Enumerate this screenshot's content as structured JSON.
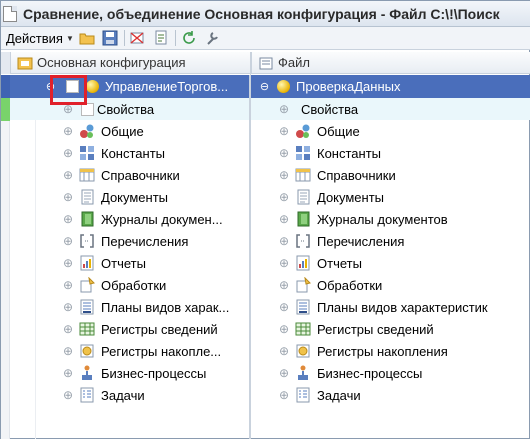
{
  "window": {
    "title": "Сравнение, объединение Основная конфигурация - Файл C:\\!\\Поиск"
  },
  "toolbar": {
    "actions_label": "Действия",
    "buttons": [
      "open-folder-icon",
      "save-icon",
      "filter-icon",
      "report-icon",
      "refresh-icon",
      "settings-icon"
    ]
  },
  "left": {
    "header": "Основная конфигурация",
    "root": "УправлениеТоргов...",
    "items": [
      {
        "label": "Свойства",
        "icon": "checkbox-icon"
      },
      {
        "label": "Общие",
        "icon": "common-icon"
      },
      {
        "label": "Константы",
        "icon": "constants-icon"
      },
      {
        "label": "Справочники",
        "icon": "catalogs-icon"
      },
      {
        "label": "Документы",
        "icon": "documents-icon"
      },
      {
        "label": "Журналы докумен...",
        "icon": "journals-icon"
      },
      {
        "label": "Перечисления",
        "icon": "enums-icon"
      },
      {
        "label": "Отчеты",
        "icon": "reports-icon"
      },
      {
        "label": "Обработки",
        "icon": "processing-icon"
      },
      {
        "label": "Планы видов харак...",
        "icon": "chart-types-icon"
      },
      {
        "label": "Регистры сведений",
        "icon": "info-registers-icon"
      },
      {
        "label": "Регистры накопле...",
        "icon": "accumulation-registers-icon"
      },
      {
        "label": "Бизнес-процессы",
        "icon": "business-processes-icon"
      },
      {
        "label": "Задачи",
        "icon": "tasks-icon"
      }
    ]
  },
  "right": {
    "header": "Файл",
    "root": "ПроверкаДанных",
    "items": [
      {
        "label": "Свойства",
        "icon": "none"
      },
      {
        "label": "Общие",
        "icon": "common-icon"
      },
      {
        "label": "Константы",
        "icon": "constants-icon"
      },
      {
        "label": "Справочники",
        "icon": "catalogs-icon"
      },
      {
        "label": "Документы",
        "icon": "documents-icon"
      },
      {
        "label": "Журналы документов",
        "icon": "journals-icon"
      },
      {
        "label": "Перечисления",
        "icon": "enums-icon"
      },
      {
        "label": "Отчеты",
        "icon": "reports-icon"
      },
      {
        "label": "Обработки",
        "icon": "processing-icon"
      },
      {
        "label": "Планы видов характеристик",
        "icon": "chart-types-icon"
      },
      {
        "label": "Регистры сведений",
        "icon": "info-registers-icon"
      },
      {
        "label": "Регистры накопления",
        "icon": "accumulation-registers-icon"
      },
      {
        "label": "Бизнес-процессы",
        "icon": "business-processes-icon"
      },
      {
        "label": "Задачи",
        "icon": "tasks-icon"
      }
    ]
  },
  "colors": {
    "selection": "#4a6ebb",
    "highlight_frame": "#e0202a",
    "stripe_green": "#79d36b",
    "properties_row": "#eaf7fb"
  }
}
